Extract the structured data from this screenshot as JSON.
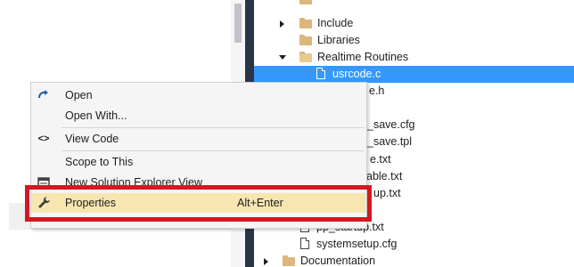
{
  "tree": {
    "items": [
      {
        "label": "Include",
        "kind": "folder",
        "expander": "collapsed"
      },
      {
        "label": "Libraries",
        "kind": "folder",
        "expander": "none"
      },
      {
        "label": "Realtime Routines",
        "kind": "folder-open",
        "expander": "expanded"
      },
      {
        "label": "usrcode.c",
        "kind": "file",
        "selected": true
      },
      {
        "label": "e.h",
        "kind": "file-partial"
      },
      {
        "label": "_save.cfg",
        "kind": "file-partial"
      },
      {
        "label": "_save.tpl",
        "kind": "file-partial"
      },
      {
        "label": "e.txt",
        "kind": "file-partial"
      },
      {
        "label": "able.txt",
        "kind": "file-partial"
      },
      {
        "label": "up.txt",
        "kind": "file-partial"
      },
      {
        "label": "pp_startup.txt",
        "kind": "file"
      },
      {
        "label": "systemsetup.cfg",
        "kind": "file"
      },
      {
        "label": "Documentation",
        "kind": "folder",
        "expander": "collapsed"
      }
    ]
  },
  "context_menu": {
    "items": [
      {
        "label": "Open",
        "icon": "open-arrow-icon"
      },
      {
        "label": "Open With...",
        "icon": ""
      },
      {
        "label": "View Code",
        "icon": "code-brackets-icon"
      },
      {
        "label": "Scope to This",
        "icon": ""
      },
      {
        "label": "New Solution Explorer View",
        "icon": "new-window-icon"
      },
      {
        "label": "Properties",
        "icon": "wrench-icon",
        "shortcut": "Alt+Enter",
        "highlighted": true
      }
    ]
  },
  "colors": {
    "selection": "#3399ff",
    "highlight": "#f7e6b0",
    "annotation_red": "#d31920",
    "splitter": "#2b3446"
  }
}
